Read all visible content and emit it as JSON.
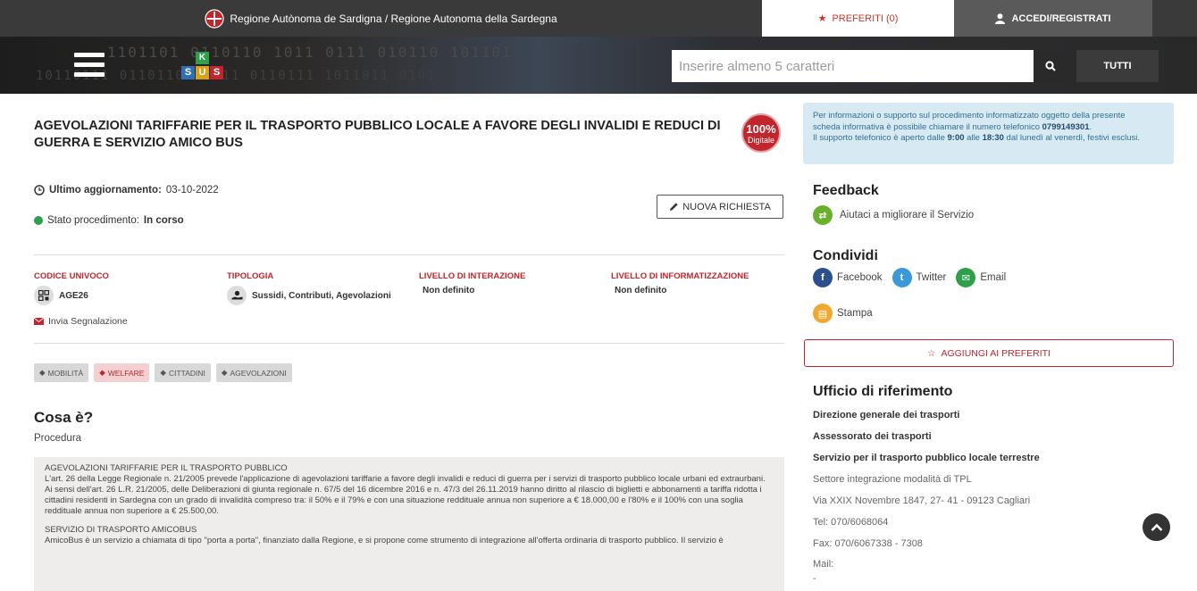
{
  "topbar": {
    "region": "Regione Autònoma de Sardigna / Regione Autonoma della Sardegna",
    "favorites": "PREFERITI (0)",
    "login": "ACCEDI/REGISTRATI"
  },
  "header": {
    "logo_letters": [
      "K",
      "S",
      "U",
      "S"
    ],
    "search_placeholder": "Inserire almeno 5 caratteri",
    "filter_label": "TUTTI"
  },
  "service": {
    "title": "AGEVOLAZIONI TARIFFARIE PER IL TRASPORTO PUBBLICO LOCALE A FAVORE DEGLI INVALIDI E REDUCI DI GUERRA E SERVIZIO AMICO BUS",
    "badge_pct": "100%",
    "badge_label": "Digitale",
    "last_update_label": "Ultimo aggiornamento:",
    "last_update_value": "03-10-2022",
    "status_label": "Stato procedimento:",
    "status_value": "In corso",
    "new_request": "NUOVA RICHIESTA"
  },
  "info": {
    "line1": "Per informazioni o supporto sul procedimento informatizzato oggetto della presente",
    "line2a": "scheda informativa è possibile chiamare il numero telefonico ",
    "phone": "0799149301",
    "line2b": ".",
    "line3a": "Il supporto telefonico è aperto dalle ",
    "from": "9:00",
    "line3b": " alle ",
    "to": "18:30",
    "line3c": " dal lunedì al venerdì, festivi esclusi."
  },
  "codes": {
    "codice_label": "CODICE UNIVOCO",
    "codice_value": "AGE26",
    "tipologia_label": "TIPOLOGIA",
    "tipologia_value": "Sussidi, Contributi, Agevolazioni",
    "interazione_label": "LIVELLO DI INTERAZIONE",
    "interazione_value": "Non definito",
    "informatizzazione_label": "LIVELLO DI INFORMATIZZAZIONE",
    "informatizzazione_value": "Non definito"
  },
  "report": "Invia Segnalazione",
  "tags": [
    "MOBILITÀ",
    "WELFARE",
    "CITTADINI",
    "AGEVOLAZIONI"
  ],
  "content": {
    "heading": "Cosa è?",
    "subheading": "Procedura",
    "p1_title": "AGEVOLAZIONI TARIFFARIE PER IL TRASPORTO PUBBLICO",
    "p1_text": "L'art. 26 della Legge Regionale n. 21/2005 prevede l'applicazione di agevolazioni tariffarie a favore degli invalidi e reduci di guerra per i servizi di trasporto pubblico locale urbani ed extraurbani.",
    "p1_text2": "Ai sensi dell'art. 26 L.R. 21/2005, delle Deliberazioni di giunta regionale n. 67/5 del 16 dicembre 2016 e n. 47/3 del 26.11.2019 hanno diritto al rilascio di biglietti e abbonamenti a tariffa ridotta i cittadini residenti in Sardegna con un grado di invalidità compreso tra: il 50% e il 79% e con una situazione reddituale annua non superiore a € 18.000,00 e l'80% e il 100% con una soglia reddituale annua non superiore a € 25.500,00.",
    "p2_title": "SERVIZIO DI TRASPORTO AMICOBUS",
    "p2_text": "AmicoBus è un servizio a chiamata di tipo \"porta a porta\", finanziato dalla Regione, e si propone come strumento di integrazione all'offerta ordinaria di trasporto pubblico. Il servizio è"
  },
  "sidebar": {
    "feedback_title": "Feedback",
    "feedback_link": "Aiutaci a migliorare il Servizio",
    "share_title": "Condividi",
    "facebook": "Facebook",
    "twitter": "Twitter",
    "email": "Email",
    "print": "Stampa",
    "add_fav": "AGGIUNGI AI PREFERITI",
    "office_title": "Ufficio di riferimento",
    "office": {
      "l1": "Direzione generale dei trasporti",
      "l2": "Assessorato dei trasporti",
      "l3": "Servizio per il trasporto pubblico locale terrestre",
      "l4": "Settore integrazione modalità di TPL",
      "l5": "Via XXIX Novembre 1847, 27- 41 - 09123 Cagliari",
      "l6": "Tel: 070/6068064",
      "l7": "Fax: 070/6067338 - 7308",
      "l8": "Mail:",
      "l9": "-"
    }
  },
  "colors": {
    "accent_red": "#c0262e",
    "green": "#2e9f4a",
    "info_bg": "#d7e9f3"
  }
}
